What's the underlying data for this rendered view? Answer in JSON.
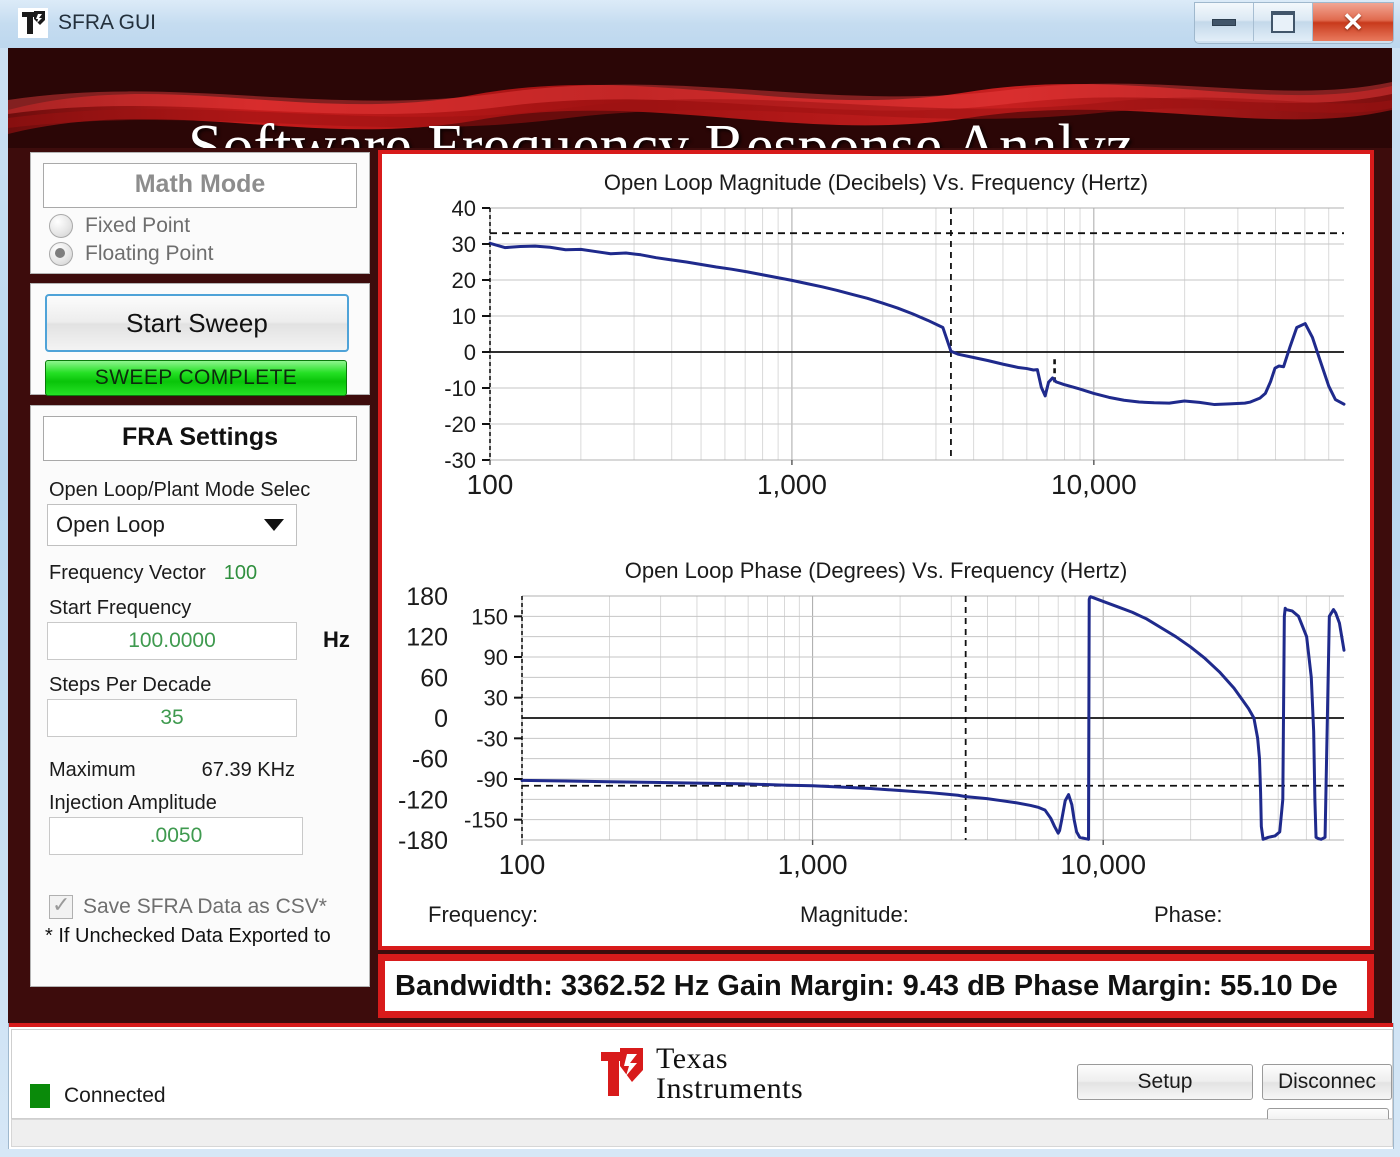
{
  "window": {
    "title": "SFRA GUI",
    "icon": "ti-logo-icon",
    "controls": {
      "minimize": "minimize-icon",
      "maximize": "maximize-icon",
      "close": "close-icon"
    }
  },
  "banner": {
    "title": "Software Frequency Response Analyz"
  },
  "math_mode": {
    "header": "Math Mode",
    "options": [
      {
        "label": "Fixed Point",
        "selected": false
      },
      {
        "label": "Floating Point",
        "selected": true
      }
    ]
  },
  "sweep": {
    "start_button": "Start Sweep",
    "status": "SWEEP COMPLETE",
    "status_color": "#12d212"
  },
  "fra_settings": {
    "header": "FRA Settings",
    "mode_label": "Open Loop/Plant Mode Selec",
    "mode_value": "Open Loop",
    "frequency_vector_label": "Frequency Vector",
    "frequency_vector_value": "100",
    "start_frequency_label": "Start Frequency",
    "start_frequency_value": "100.0000",
    "start_frequency_unit": "Hz",
    "steps_per_decade_label": "Steps Per Decade",
    "steps_per_decade_value": "35",
    "maximum_label": "Maximum",
    "maximum_value": "67.39 KHz",
    "injection_amplitude_label": "Injection Amplitude",
    "injection_amplitude_value": ".0050",
    "save_csv_label": "Save SFRA Data as CSV*",
    "save_csv_checked": true,
    "csv_note": "* If Unchecked Data Exported to"
  },
  "readouts": {
    "frequency_label": "Frequency:",
    "magnitude_label": "Magnitude:",
    "phase_label": "Phase:"
  },
  "results": {
    "text": "Bandwidth: 3362.52 Hz Gain Margin: 9.43 dB    Phase Margin: 55.10 De",
    "bandwidth_label": "Bandwidth:",
    "bandwidth_value": "3362.52 Hz",
    "gain_margin_label": "Gain Margin:",
    "gain_margin_value": "9.43 dB",
    "phase_margin_label": "Phase Margin:",
    "phase_margin_value": "55.10 De"
  },
  "footer": {
    "connection_status": "Connected",
    "connection_color": "#0a8a0a",
    "logo_line1": "Texas",
    "logo_line2": "Instruments",
    "setup_button": "Setup",
    "disconnect_button": "Disconnec",
    "blank_button": ""
  },
  "chart_data": [
    {
      "type": "line",
      "id": "magnitude",
      "title": "Open Loop Magnitude (Decibels) Vs. Frequency (Hertz)",
      "xlabel": "",
      "ylabel": "",
      "xscale": "log",
      "xlim": [
        100,
        67390
      ],
      "ylim": [
        -30,
        40
      ],
      "yticks": [
        40,
        30,
        20,
        10,
        0,
        -10,
        -20,
        -30
      ],
      "xticks": [
        100,
        1000,
        10000
      ],
      "xticklabels": [
        "100",
        "1,000",
        "10,000"
      ],
      "grid": true,
      "legend": "none",
      "series": [
        {
          "name": "Open Loop Magnitude",
          "color": "#1f2a8c",
          "x": [
            100,
            112,
            126,
            141,
            158,
            178,
            200,
            224,
            251,
            282,
            316,
            355,
            398,
            447,
            501,
            562,
            631,
            708,
            794,
            891,
            1000,
            1122,
            1259,
            1413,
            1585,
            1778,
            1995,
            2239,
            2512,
            2818,
            3162,
            3363,
            3548,
            3981,
            4467,
            5012,
            5623,
            6000,
            6310,
            6500,
            6700,
            6900,
            7079,
            7300,
            7500,
            7943,
            8913,
            10000,
            11220,
            12589,
            14125,
            15849,
            17783,
            19953,
            22387,
            25119,
            28184,
            31623,
            33000,
            35481,
            37000,
            38500,
            39811,
            41000,
            42500,
            44668,
            47000,
            50119,
            53000,
            56234,
            60000,
            63096,
            67390
          ],
          "y": [
            30.2,
            29.0,
            29.3,
            29.4,
            29.1,
            28.4,
            28.5,
            27.9,
            27.3,
            27.5,
            27.0,
            26.2,
            25.6,
            25.0,
            24.3,
            23.6,
            23.0,
            22.3,
            21.5,
            20.7,
            19.9,
            19.0,
            18.1,
            17.1,
            16.0,
            14.9,
            13.6,
            12.2,
            10.6,
            8.8,
            6.8,
            0.2,
            -0.6,
            -1.5,
            -2.4,
            -3.4,
            -4.3,
            -4.6,
            -5.0,
            -4.9,
            -9.8,
            -12.2,
            -8.4,
            -7.2,
            -8.3,
            -9.0,
            -10.2,
            -11.5,
            -12.6,
            -13.4,
            -13.9,
            -14.1,
            -14.2,
            -13.6,
            -14.0,
            -14.6,
            -14.4,
            -14.2,
            -13.9,
            -12.8,
            -11.5,
            -8.2,
            -4.5,
            -3.9,
            -4.1,
            1.5,
            6.8,
            7.9,
            4.0,
            -2.5,
            -9.5,
            -13.2,
            -14.5
          ]
        }
      ],
      "markers": {
        "hline_dashed": 33.0,
        "hline_solid": 0.0,
        "vline_dashed_freq": 3363,
        "vline_short_freq": 7413
      }
    },
    {
      "type": "line",
      "id": "phase",
      "title": "Open Loop Phase (Degrees) Vs. Frequency (Hertz)",
      "xlabel": "",
      "ylabel": "",
      "xscale": "log",
      "xlim": [
        100,
        67390
      ],
      "ylim": [
        -180,
        180
      ],
      "yticks_outer": [
        180,
        120,
        60,
        0,
        -60,
        -120,
        -180
      ],
      "yticks_inner": [
        150,
        90,
        30,
        -30,
        -90,
        -150
      ],
      "xticks": [
        100,
        1000,
        10000
      ],
      "xticklabels": [
        "100",
        "1,000",
        "10,000"
      ],
      "grid": true,
      "legend": "none",
      "series": [
        {
          "name": "Open Loop Phase",
          "color": "#1f2a8c",
          "x": [
            100,
            141,
            200,
            282,
            398,
            562,
            794,
            1000,
            1259,
            1585,
            1995,
            2512,
            2818,
            3162,
            3363,
            3981,
            4467,
            5012,
            5623,
            6000,
            6310,
            6600,
            6800,
            7000,
            7079,
            7200,
            7400,
            7600,
            7800,
            7943,
            8100,
            8300,
            8900,
            8950,
            9000,
            9050,
            10000,
            11220,
            12589,
            14125,
            15849,
            17783,
            19953,
            22387,
            25119,
            28184,
            31623,
            33000,
            34000,
            34500,
            34800,
            35000,
            35500,
            37000,
            39000,
            40500,
            41500,
            42000,
            42300,
            42600,
            44668,
            47000,
            50119,
            52000,
            53000,
            53500,
            54000,
            55000,
            56234,
            58000,
            60000,
            62000,
            63096,
            65000,
            67390
          ],
          "y": [
            -92,
            -93,
            -94,
            -95,
            -96,
            -97,
            -99,
            -100,
            -102,
            -104,
            -107,
            -110,
            -112,
            -114,
            -116,
            -119,
            -122,
            -125,
            -129,
            -132,
            -136,
            -148,
            -160,
            -170,
            -166,
            -150,
            -122,
            -113,
            -128,
            -150,
            -168,
            -176,
            -179,
            175,
            178,
            179,
            172,
            164,
            156,
            146,
            133,
            120,
            105,
            88,
            68,
            44,
            14,
            0,
            -30,
            -60,
            -110,
            -160,
            -179,
            -176,
            -174,
            -168,
            -120,
            150,
            162,
            160,
            158,
            150,
            120,
            60,
            -20,
            -120,
            -176,
            -178,
            -179,
            -176,
            150,
            160,
            155,
            140,
            100
          ]
        }
      ],
      "markers": {
        "hline_dashed": -100.0,
        "hline_solid": 0.0,
        "vline_dashed_freq": 3363
      }
    }
  ]
}
